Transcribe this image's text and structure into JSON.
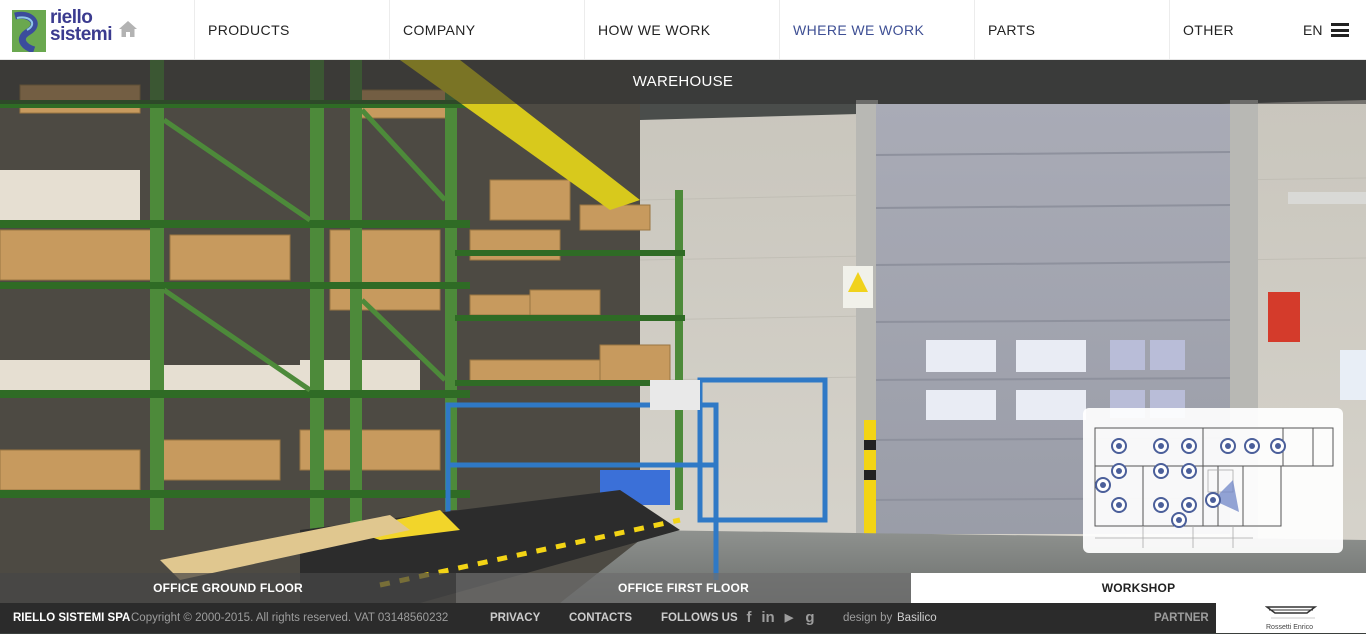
{
  "logo": {
    "line1": "riello",
    "line2": "sistemi"
  },
  "header": {
    "home_icon": "home-icon",
    "nav": [
      {
        "label": "PRODUCTS",
        "active": false
      },
      {
        "label": "COMPANY",
        "active": false
      },
      {
        "label": "HOW WE WORK",
        "active": false
      },
      {
        "label": "WHERE WE WORK",
        "active": true
      },
      {
        "label": "PARTS",
        "active": false
      },
      {
        "label": "OTHER",
        "active": false
      }
    ],
    "language": "EN",
    "menu_icon": "hamburger-icon",
    "active_color": "#3e4f94"
  },
  "view": {
    "title": "WAREHOUSE"
  },
  "minimap": {
    "marker_count": 16,
    "marker_color": "#4b5f9a",
    "icons": [
      "map-marker-icon",
      "view-direction-icon"
    ]
  },
  "floors": [
    {
      "label": "OFFICE GROUND FLOOR",
      "selected": false
    },
    {
      "label": "OFFICE FIRST FLOOR",
      "selected": false
    },
    {
      "label": "WORKSHOP",
      "selected": true
    }
  ],
  "footer": {
    "company": "RIELLO SISTEMI SPA",
    "copyright": "Copyright © 2000-2015. All rights reserved. VAT 03148560232",
    "privacy": "PRIVACY",
    "contacts": "CONTACTS",
    "follow": "FOLLOWS US",
    "social": [
      {
        "icon": "facebook-icon",
        "glyph": "f"
      },
      {
        "icon": "linkedin-icon",
        "glyph": "in"
      },
      {
        "icon": "youtube-icon",
        "glyph": "▶"
      },
      {
        "icon": "google-plus-icon",
        "glyph": "g"
      }
    ],
    "design_prefix": "design by",
    "design_name": "Basilico",
    "partner_label": "PARTNER",
    "partner_name": "Rossetti Enrico"
  }
}
